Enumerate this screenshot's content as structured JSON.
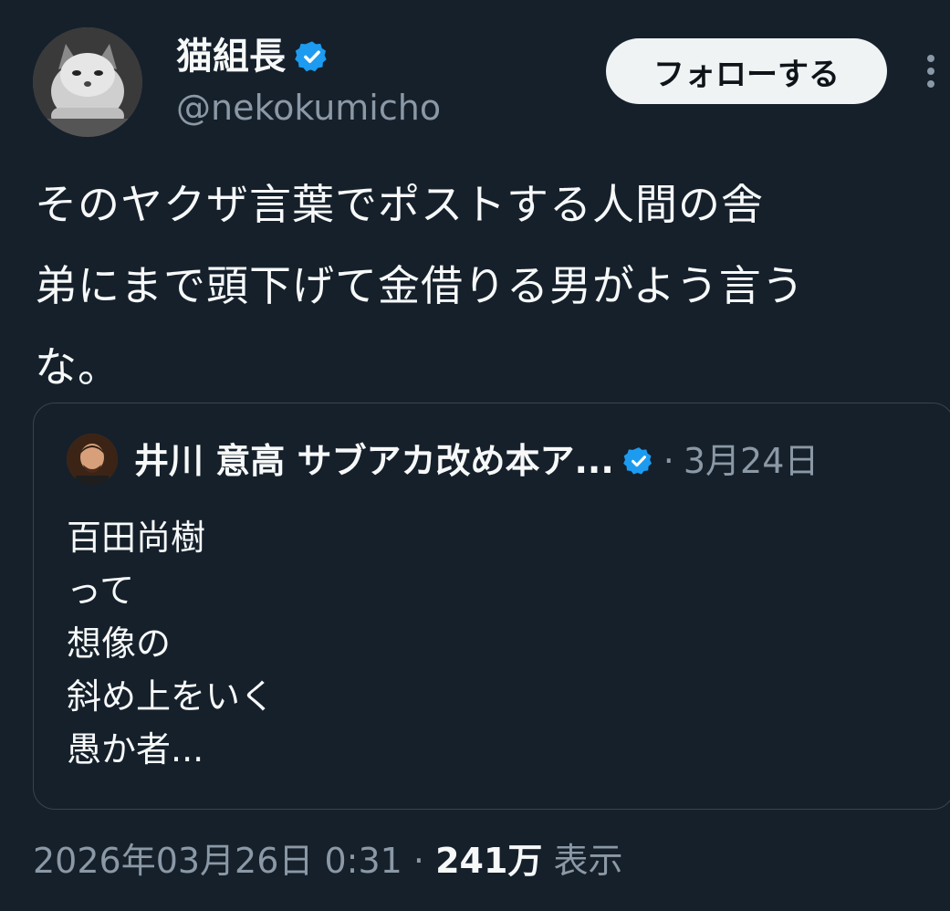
{
  "author": {
    "display_name": "猫組長",
    "handle": "@nekokumicho",
    "avatar_icon": "cat-avatar",
    "verified_icon": "verified-badge-icon"
  },
  "follow_button_label": "フォローする",
  "more_icon": "more-options-icon",
  "post_text": "そのヤクザ言葉でポストする人間の舎\n弟にまで頭下げて金借りる男がよう言う\nな。",
  "quote": {
    "author_name": "井川 意高 サブアカ改め本ア...",
    "separator": "·",
    "date": "3月24日",
    "lines": [
      "百田尚樹",
      "って",
      "想像の",
      "斜め上をいく",
      "愚か者..."
    ]
  },
  "meta": {
    "timestamp": "2026年03月26日 0:31",
    "separator": " · ",
    "views_count": "241万",
    "views_label": " 表示"
  },
  "colors": {
    "background": "#15202b",
    "text": "#f7f9f9",
    "secondary_text": "#8b98a5",
    "verified": "#1d9bf0",
    "border": "#38444d"
  }
}
